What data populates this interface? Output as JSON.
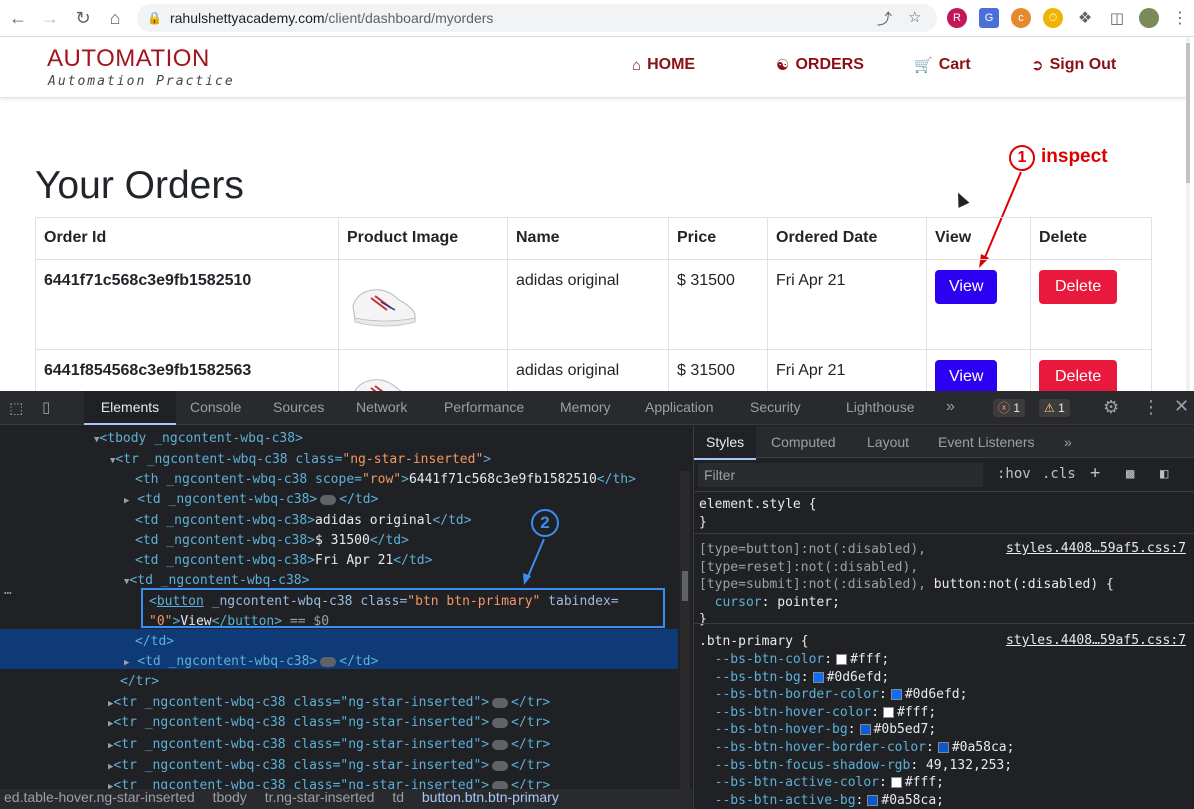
{
  "browser": {
    "url_host": "rahulshettyacademy.com",
    "url_path": "/client/dashboard/myorders"
  },
  "site": {
    "brand": "AUTOMATION",
    "tagline": "Automation Practice",
    "nav": [
      "HOME",
      "ORDERS",
      "Cart",
      "Sign Out"
    ]
  },
  "orders": {
    "title": "Your Orders",
    "columns": [
      "Order Id",
      "Product Image",
      "Name",
      "Price",
      "Ordered Date",
      "View",
      "Delete"
    ],
    "rows": [
      {
        "id": "6441f71c568c3e9fb1582510",
        "name": "adidas original",
        "price": "$ 31500",
        "date": "Fri Apr 21",
        "view": "View",
        "delete": "Delete"
      },
      {
        "id": "6441f854568c3e9fb1582563",
        "name": "adidas original",
        "price": "$ 31500",
        "date": "Fri Apr 21",
        "view": "View",
        "delete": "Delete"
      }
    ]
  },
  "annotations": {
    "one_num": "1",
    "one_text": "inspect",
    "two_num": "2"
  },
  "devtools": {
    "tabs": [
      "Elements",
      "Console",
      "Sources",
      "Network",
      "Performance",
      "Memory",
      "Application",
      "Security",
      "Lighthouse"
    ],
    "errors": "1",
    "warnings": "1",
    "dom": {
      "l1": "<tbody _ngcontent-wbq-c38>",
      "l2a": "<tr _ngcontent-wbq-c38 class=",
      "l2b": "\"ng-star-inserted\"",
      "l3a": "<th _ngcontent-wbq-c38 scope=",
      "l3b": "\"row\"",
      "l3c": "6441f71c568c3e9fb1582510",
      "l4": "<td _ngcontent-wbq-c38>",
      "l5": "adidas original",
      "l6": "$ 31500",
      "l7": "Fri Apr 21",
      "sel1a": "button",
      "sel1b": " _ngcontent-wbq-c38 class=",
      "sel1c": "\"btn btn-primary\"",
      "sel1d": " tabindex=",
      "sel2a": "\"0\"",
      "sel2b": "View",
      "sel2c": " == $0",
      "end_td": "</td>",
      "end_tr": "</tr>",
      "tr_row": "<tr _ngcontent-wbq-c38 class=\"ng-star-inserted\">"
    },
    "breadcrumb": [
      "ed.table-hover.ng-star-inserted",
      "tbody",
      "tr.ng-star-inserted",
      "td",
      "button.btn.btn-primary"
    ],
    "styles_tabs": [
      "Styles",
      "Computed",
      "Layout",
      "Event Listeners"
    ],
    "filter_placeholder": "Filter",
    "hov": ":hov",
    "cls": ".cls",
    "rules": {
      "element_style": "element.style {",
      "close": "}",
      "r2_sel1": "[type=button]:not(:disabled),",
      "r2_sel2": "[type=reset]:not(:disabled),",
      "r2_sel3a": "[type=submit]:not(:disabled),",
      "r2_sel3b": " button:not(:disabled) {",
      "r2_prop": "cursor",
      "r2_val": "pointer;",
      "src": "styles.4408…59af5.css:7",
      "r3_sel": ".btn-primary {",
      "vars": [
        {
          "name": "--bs-btn-color",
          "color": "#ffffff",
          "value": "#fff;"
        },
        {
          "name": "--bs-btn-bg",
          "color": "#0d6efd",
          "value": "#0d6efd;"
        },
        {
          "name": "--bs-btn-border-color",
          "color": "#0d6efd",
          "value": "#0d6efd;"
        },
        {
          "name": "--bs-btn-hover-color",
          "color": "#ffffff",
          "value": "#fff;"
        },
        {
          "name": "--bs-btn-hover-bg",
          "color": "#0b5ed7",
          "value": "#0b5ed7;"
        },
        {
          "name": "--bs-btn-hover-border-color",
          "color": "#0a58ca",
          "value": "#0a58ca;"
        },
        {
          "name": "--bs-btn-focus-shadow-rgb",
          "color": "",
          "value": "49,132,253;"
        },
        {
          "name": "--bs-btn-active-color",
          "color": "#ffffff",
          "value": "#fff;"
        },
        {
          "name": "--bs-btn-active-bg",
          "color": "#0a58ca",
          "value": "#0a58ca;"
        }
      ]
    }
  }
}
